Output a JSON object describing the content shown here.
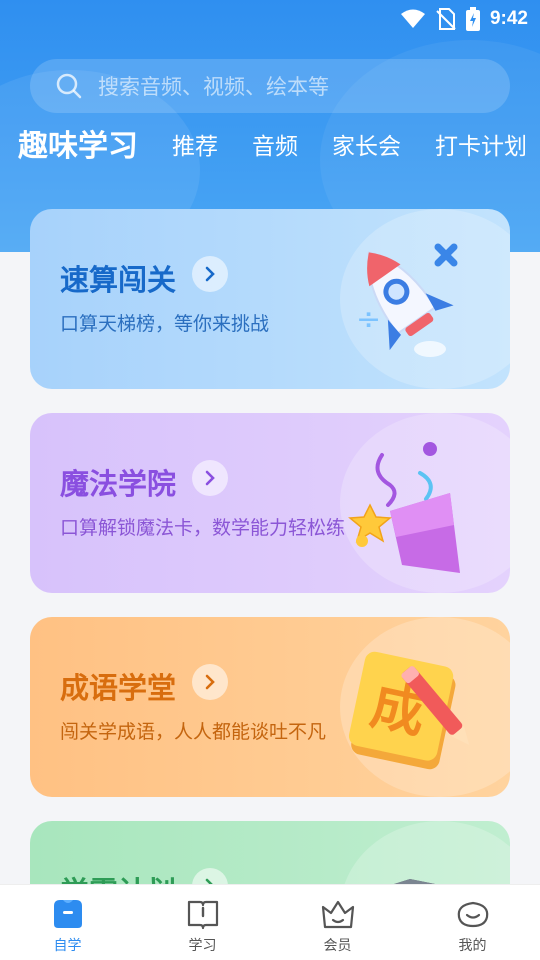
{
  "status": {
    "time": "9:42"
  },
  "search": {
    "placeholder": "搜索音频、视频、绘本等"
  },
  "tabs": [
    {
      "label": "趣味学习",
      "active": true
    },
    {
      "label": "推荐"
    },
    {
      "label": "音频"
    },
    {
      "label": "家长会"
    },
    {
      "label": "打卡计划"
    }
  ],
  "cards": [
    {
      "title": "速算闯关",
      "subtitle": "口算天梯榜，等你来挑战",
      "icon": "rocket-icon",
      "accent": "#1769c9"
    },
    {
      "title": "魔法学院",
      "subtitle": "口算解锁魔法卡，数学能力轻松练",
      "icon": "party-popper-icon",
      "accent": "#8a4fe0"
    },
    {
      "title": "成语学堂",
      "subtitle": "闯关学成语，人人都能谈吐不凡",
      "icon": "idiom-book-icon",
      "accent": "#d86d0e"
    },
    {
      "title": "学霸计划",
      "icon": "graduation-cap-icon",
      "accent": "#2e9c56"
    }
  ],
  "bottom_nav": [
    {
      "label": "自学",
      "icon": "self-study-icon",
      "active": true
    },
    {
      "label": "学习",
      "icon": "book-icon"
    },
    {
      "label": "会员",
      "icon": "crown-icon"
    },
    {
      "label": "我的",
      "icon": "smile-icon"
    }
  ],
  "colors": {
    "primary": "#2d8cf0",
    "header": "#3a98f2"
  }
}
